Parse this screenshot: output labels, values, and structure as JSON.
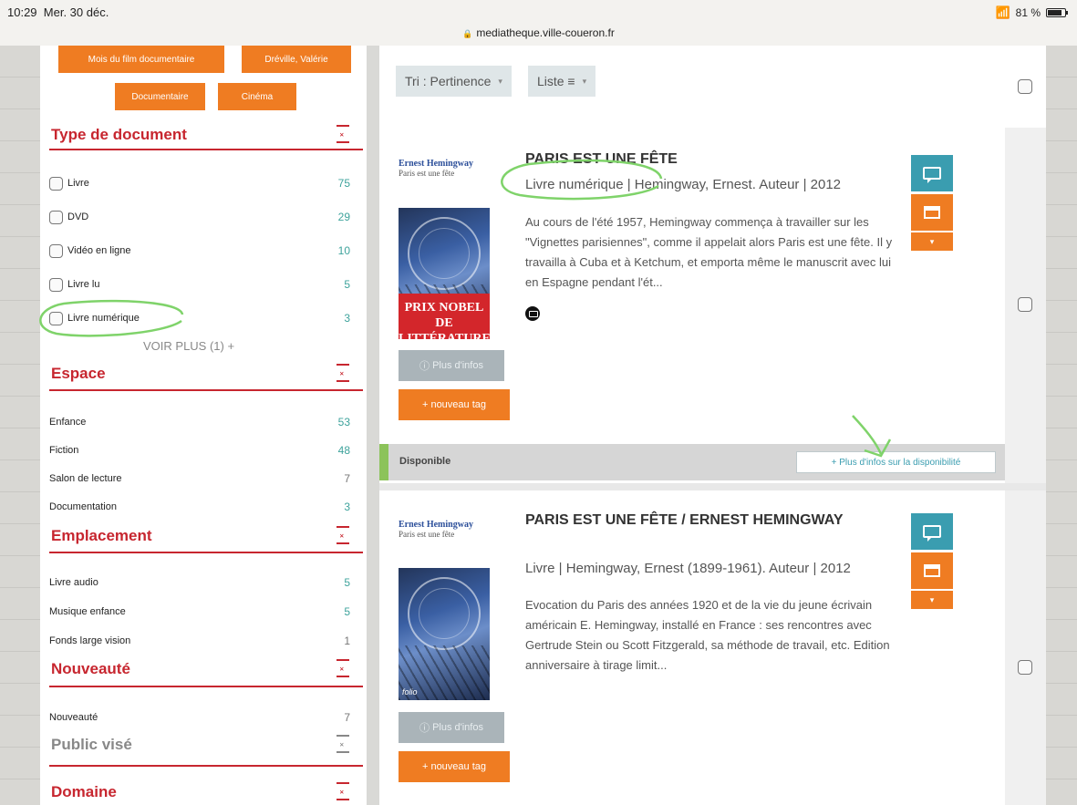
{
  "status": {
    "time": "10:29",
    "date": "Mer. 30 déc.",
    "battery": "81 %",
    "url": "mediatheque.ville-coueron.fr"
  },
  "sidebar": {
    "selected_tags": [
      "Mois du film documentaire",
      "Dréville, Valérie",
      "Documentaire",
      "Cinéma"
    ],
    "facets": {
      "type_document": {
        "title": "Type de document",
        "items": [
          {
            "label": "Livre",
            "count": "75"
          },
          {
            "label": "DVD",
            "count": "29"
          },
          {
            "label": "Vidéo en ligne",
            "count": "10"
          },
          {
            "label": "Livre lu",
            "count": "5"
          },
          {
            "label": "Livre numérique",
            "count": "3"
          }
        ],
        "more": "VOIR PLUS (1) +"
      },
      "espace": {
        "title": "Espace",
        "items": [
          {
            "label": "Enfance",
            "count": "53"
          },
          {
            "label": "Fiction",
            "count": "48"
          },
          {
            "label": "Salon de lecture",
            "count": "7"
          },
          {
            "label": "Documentation",
            "count": "3"
          }
        ]
      },
      "emplacement": {
        "title": "Emplacement",
        "items": [
          {
            "label": "Livre audio",
            "count": "5"
          },
          {
            "label": "Musique enfance",
            "count": "5"
          },
          {
            "label": "Fonds large vision",
            "count": "1"
          }
        ]
      },
      "nouveaute": {
        "title": "Nouveauté",
        "items": [
          {
            "label": "Nouveauté",
            "count": "7"
          }
        ]
      },
      "public_vise": {
        "title": "Public visé"
      },
      "domaine": {
        "title": "Domaine"
      }
    }
  },
  "main": {
    "sort": {
      "label": "Tri :",
      "value": "Pertinence"
    },
    "view": {
      "value": "Liste ≡"
    },
    "results": [
      {
        "cover_author": "Ernest Hemingway",
        "cover_subtitle": "Paris est une fête",
        "cover_badge": "PRIX NOBEL DE LITTÉRATURE",
        "title": "PARIS EST UNE FÊTE",
        "type_line": "Livre numérique | Hemingway, Ernest. Auteur | 2012",
        "description": "Au cours de l'été 1957, Hemingway commença à travailler sur les \"Vignettes parisiennes\", comme il appelait alors Paris est une fête. Il y travailla à Cuba et à Ketchum, et emporta même le manuscrit avec lui en Espagne pendant l'ét...",
        "more_info": "Plus d'infos",
        "new_tag": "+ nouveau tag",
        "availability": "Disponible",
        "availability_more": "+ Plus d'infos sur la disponibilité"
      },
      {
        "cover_author": "Ernest Hemingway",
        "cover_subtitle": "Paris est une fête",
        "cover_badge": "folio",
        "title": "PARIS EST UNE FÊTE / ERNEST HEMINGWAY",
        "type_line": "Livre | Hemingway, Ernest (1899-1961). Auteur | 2012",
        "description": "Evocation du Paris des années 1920 et de la vie du jeune écrivain américain E. Hemingway, installé en France : ses rencontres avec Gertrude Stein ou Scott Fitzgerald, sa méthode de travail, etc. Edition anniversaire à tirage limit...",
        "more_info": "Plus d'infos",
        "new_tag": "+ nouveau tag"
      }
    ]
  },
  "colors": {
    "facet_red": "#c7262f",
    "orange": "#ef7c22",
    "teal": "#3a9db0",
    "count_teal": "#3ea39c",
    "available_green": "#8cc35a",
    "annotation_green": "#7fd36a"
  }
}
